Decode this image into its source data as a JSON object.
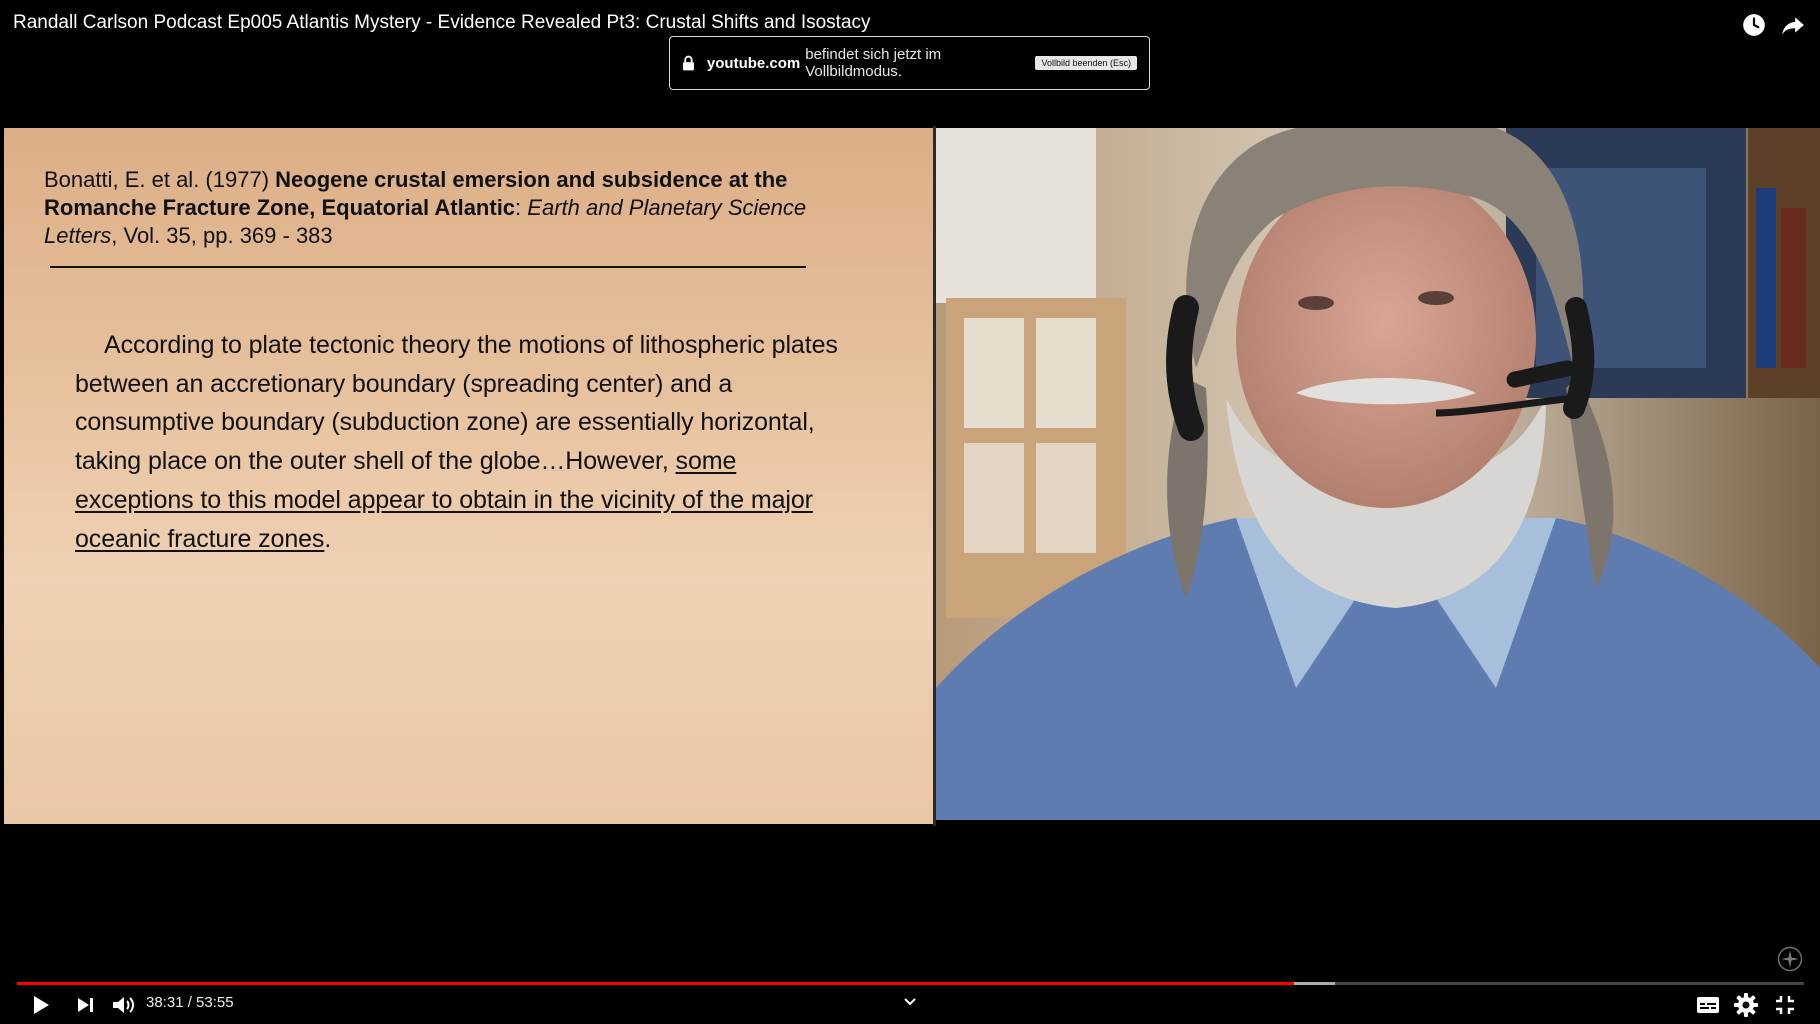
{
  "video": {
    "title": "Randall Carlson Podcast Ep005 Atlantis Mystery - Evidence Revealed Pt3: Crustal Shifts and Isostacy"
  },
  "fullscreen_notice": {
    "domain": "youtube.com",
    "message": "befindet sich jetzt im Vollbildmodus.",
    "exit_button": "Vollbild beenden (Esc)"
  },
  "slide": {
    "citation_authors": "Bonatti, E. et al. (1977)",
    "citation_title": "Neogene crustal emersion and subsidence at the Romanche Fracture Zone, Equatorial Atlantic",
    "citation_sep": ":",
    "citation_journal": "Earth and Planetary Science Letters",
    "citation_tail": ", Vol. 35,  pp. 369 - 383",
    "quote_plain": "According to plate tectonic theory the motions of lithospheric plates between an accretionary boundary (spreading center) and a consumptive boundary (subduction zone) are essentially horizontal, taking place on the outer shell of the globe…However,",
    "quote_underlined": "some exceptions to this model appear to obtain in the vicinity of the major oceanic fracture zones",
    "quote_end": "."
  },
  "player": {
    "time_display": "38:31 / 53:55",
    "progress_fraction": 0.7144,
    "buffered_fraction": 0.7378
  },
  "colors": {
    "progress_red": "#ff0000",
    "slide_bg": "#e8c39f"
  },
  "icons": {
    "watch_later": "clock-icon",
    "share": "share-icon",
    "play": "play-icon",
    "next": "next-icon",
    "volume": "volume-icon",
    "subtitles": "subtitles-icon",
    "settings": "gear-icon",
    "exit_fullscreen": "exit-fullscreen-icon"
  }
}
